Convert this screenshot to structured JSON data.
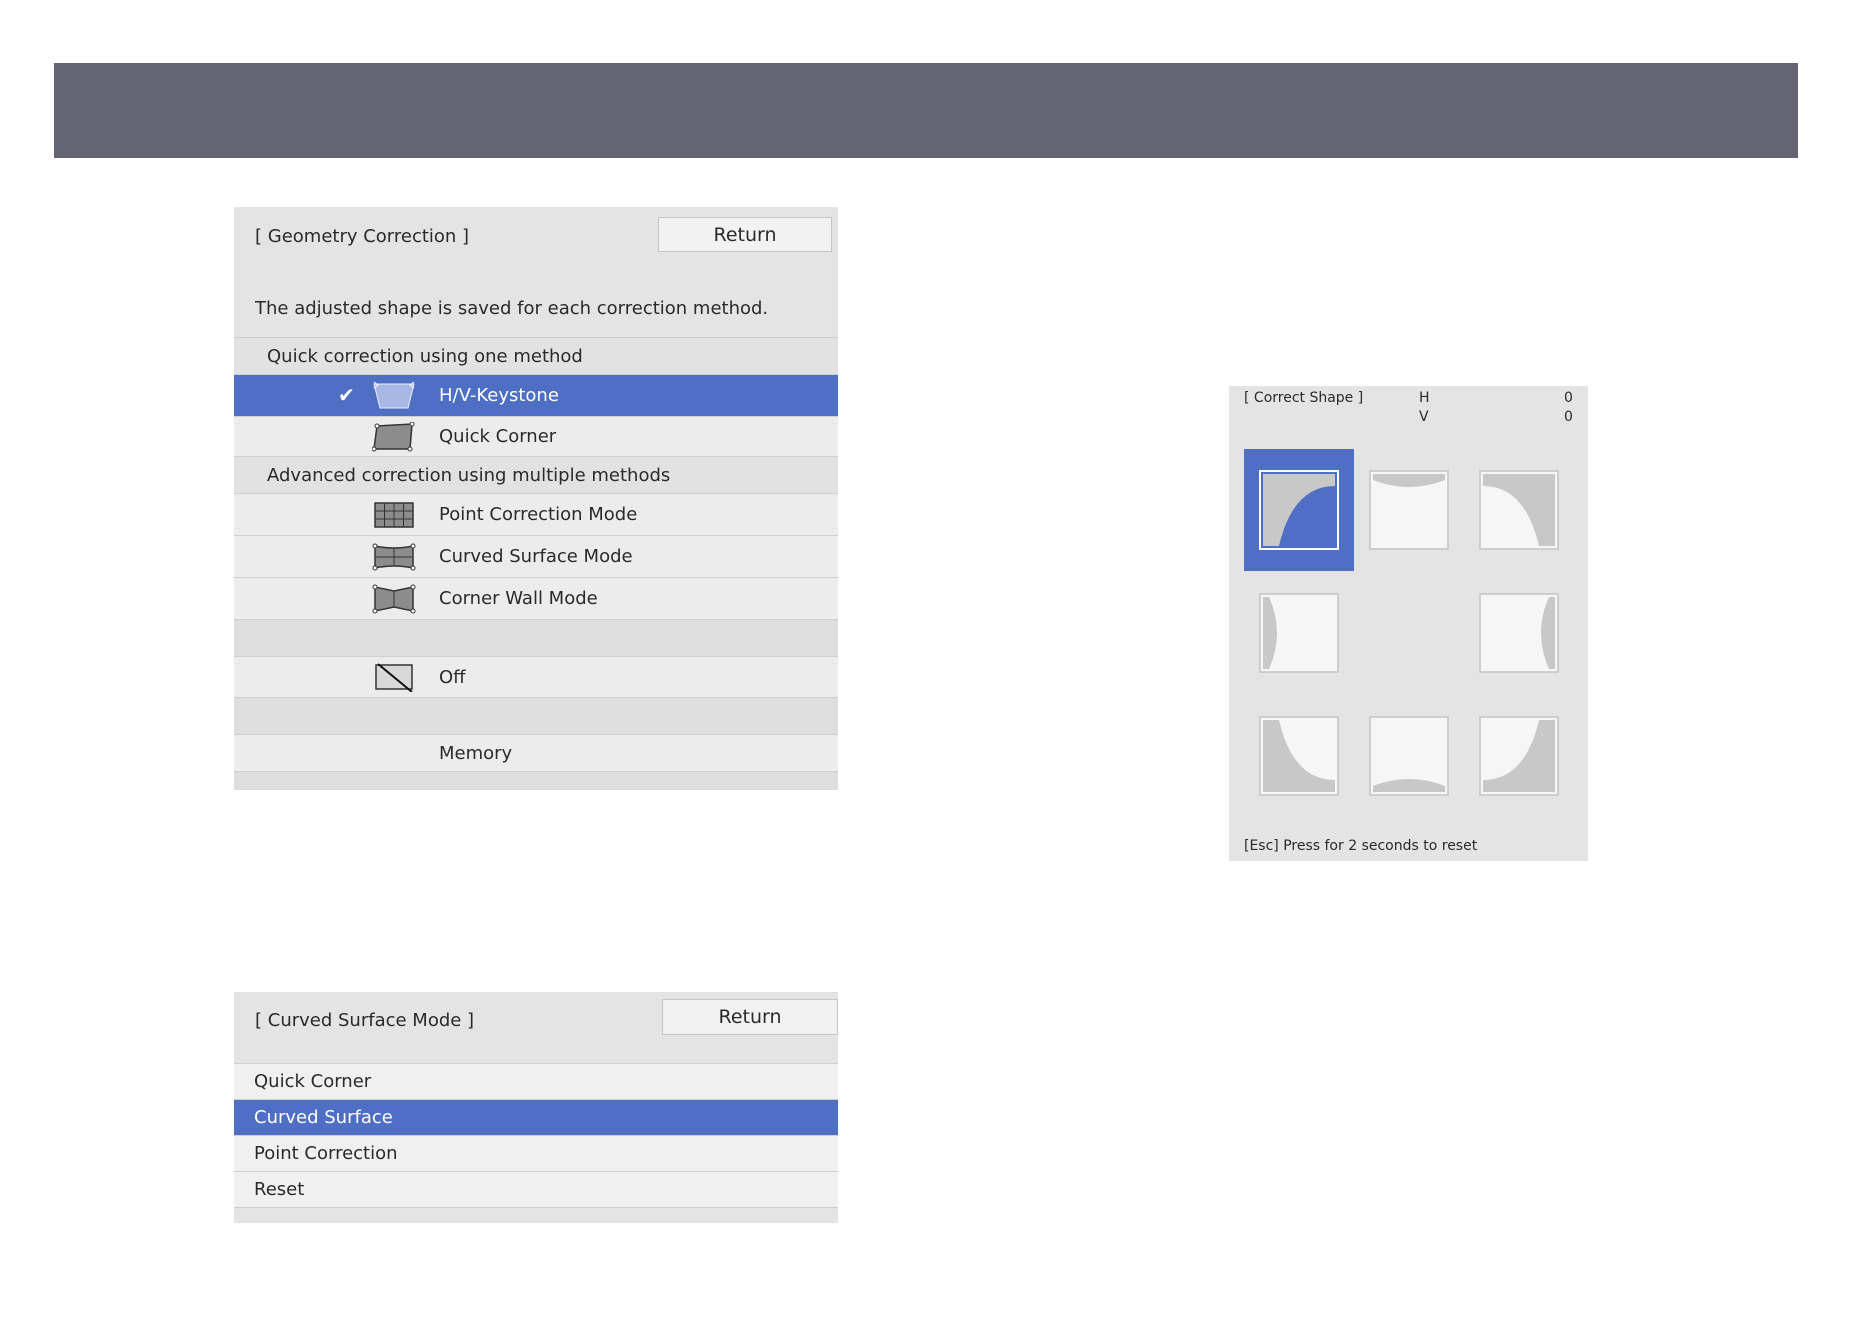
{
  "geometry": {
    "title": "[ Geometry Correction ]",
    "return_label": "Return",
    "description": "The adjusted shape is saved for each correction method.",
    "quick_header": "Quick correction using one method",
    "hv_keystone": "H/V-Keystone",
    "quick_corner": "Quick Corner",
    "advanced_header": "Advanced correction using multiple methods",
    "point_correction_mode": "Point Correction Mode",
    "curved_surface_mode": "Curved Surface Mode",
    "corner_wall_mode": "Corner Wall Mode",
    "off": "Off",
    "memory": "Memory",
    "check_mark": "✔"
  },
  "curved": {
    "title": "[ Curved Surface Mode ]",
    "return_label": "Return",
    "items": [
      "Quick Corner",
      "Curved Surface",
      "Point Correction",
      "Reset"
    ],
    "selected_index": 1
  },
  "correct_shape": {
    "title": "[ Correct Shape ]",
    "h_label": "H",
    "v_label": "V",
    "h_value": "0",
    "v_value": "0",
    "footer": "[Esc] Press for 2 seconds to reset",
    "selected_tile": "top-left"
  },
  "colors": {
    "banner": "#646474",
    "panel_bg": "#e4e4e4",
    "selection": "#4f6fc4"
  },
  "icons": [
    "check-icon",
    "keystone-icon",
    "quick-corner-icon",
    "point-correction-icon",
    "curved-surface-icon",
    "corner-wall-icon",
    "off-icon"
  ]
}
